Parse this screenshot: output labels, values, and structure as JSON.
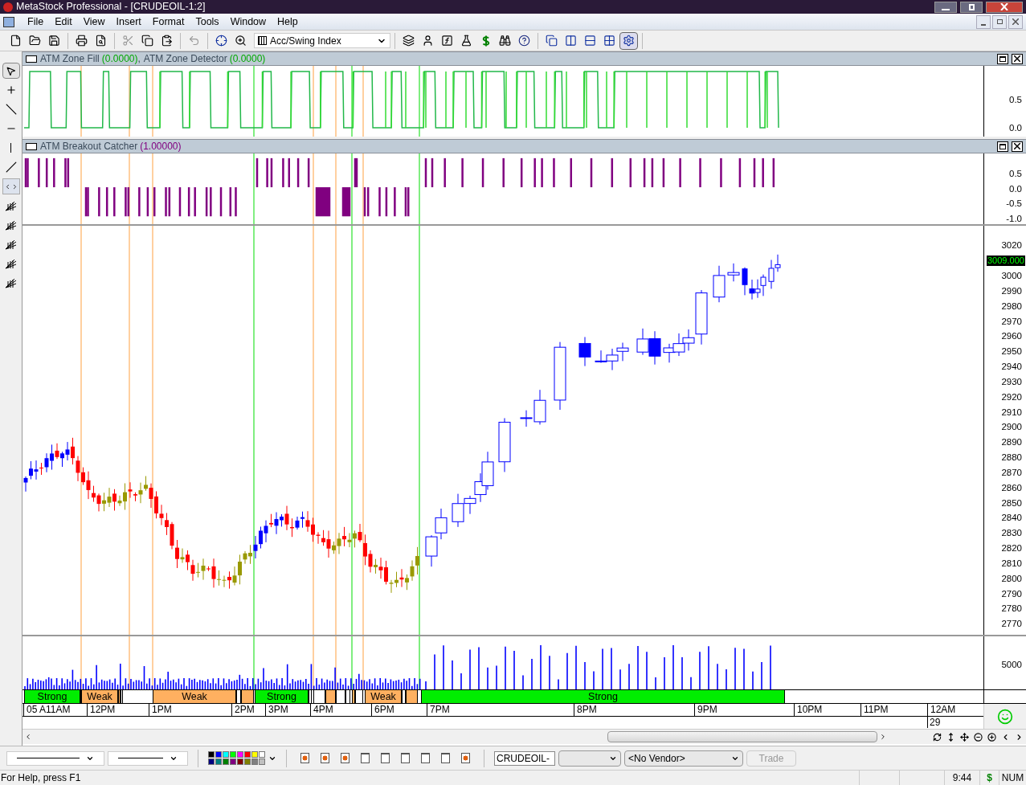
{
  "window": {
    "title": "MetaStock Professional - [CRUDEOIL-1:2]"
  },
  "menu": [
    "File",
    "Edit",
    "View",
    "Insert",
    "Format",
    "Tools",
    "Window",
    "Help"
  ],
  "toolbar": {
    "indicator_select": "Acc/Swing Index"
  },
  "panes": [
    {
      "kind": "zone",
      "indicators": [
        {
          "name": "ATM Zone Fill",
          "value": "(0.0000)",
          "separator": ",",
          "color": "#00a800"
        },
        {
          "name": "ATM Zone Detector",
          "value": "(0.0000)",
          "color": "#00a800"
        }
      ],
      "axis": [
        "0.5",
        "0.0"
      ]
    },
    {
      "kind": "breakout",
      "indicators": [
        {
          "name": "ATM Breakout Catcher",
          "value": "(1.00000)",
          "color": "#800080"
        }
      ],
      "axis": [
        "0.5",
        "0.0",
        "-0.5",
        "-1.0"
      ]
    }
  ],
  "price_axis": [
    "3020",
    "3000",
    "2990",
    "2980",
    "2970",
    "2960",
    "2950",
    "2940",
    "2930",
    "2920",
    "2910",
    "2900",
    "2890",
    "2880",
    "2870",
    "2860",
    "2850",
    "2840",
    "2830",
    "2820",
    "2810",
    "2800",
    "2790",
    "2780",
    "2770"
  ],
  "last_price": "3009.000",
  "volume_axis": [
    "5000"
  ],
  "zones": [
    {
      "label": "Strong",
      "kind": "strong"
    },
    {
      "label": "Weak",
      "kind": "weak"
    },
    {
      "label": "Weak",
      "kind": "weak"
    },
    {
      "label": "Strong",
      "kind": "strong"
    },
    {
      "label": "Weak",
      "kind": "weak"
    },
    {
      "label": "Strong",
      "kind": "strong"
    }
  ],
  "time_axis": [
    "05 A11AM",
    "12PM",
    "1PM",
    "2PM",
    "3PM",
    "4PM",
    "6PM",
    "7PM",
    "8PM",
    "9PM",
    "10PM",
    "11PM",
    "12AM"
  ],
  "date_label": "29",
  "bottom_toolbar": {
    "symbol": "CRUDEOIL-",
    "vendor": "<No Vendor>",
    "trade": {
      "label": "Trade",
      "disabled": true
    }
  },
  "status_bar": {
    "help": "For Help, press F1",
    "time": "9:44",
    "currency": "$",
    "num": "NUM"
  }
}
